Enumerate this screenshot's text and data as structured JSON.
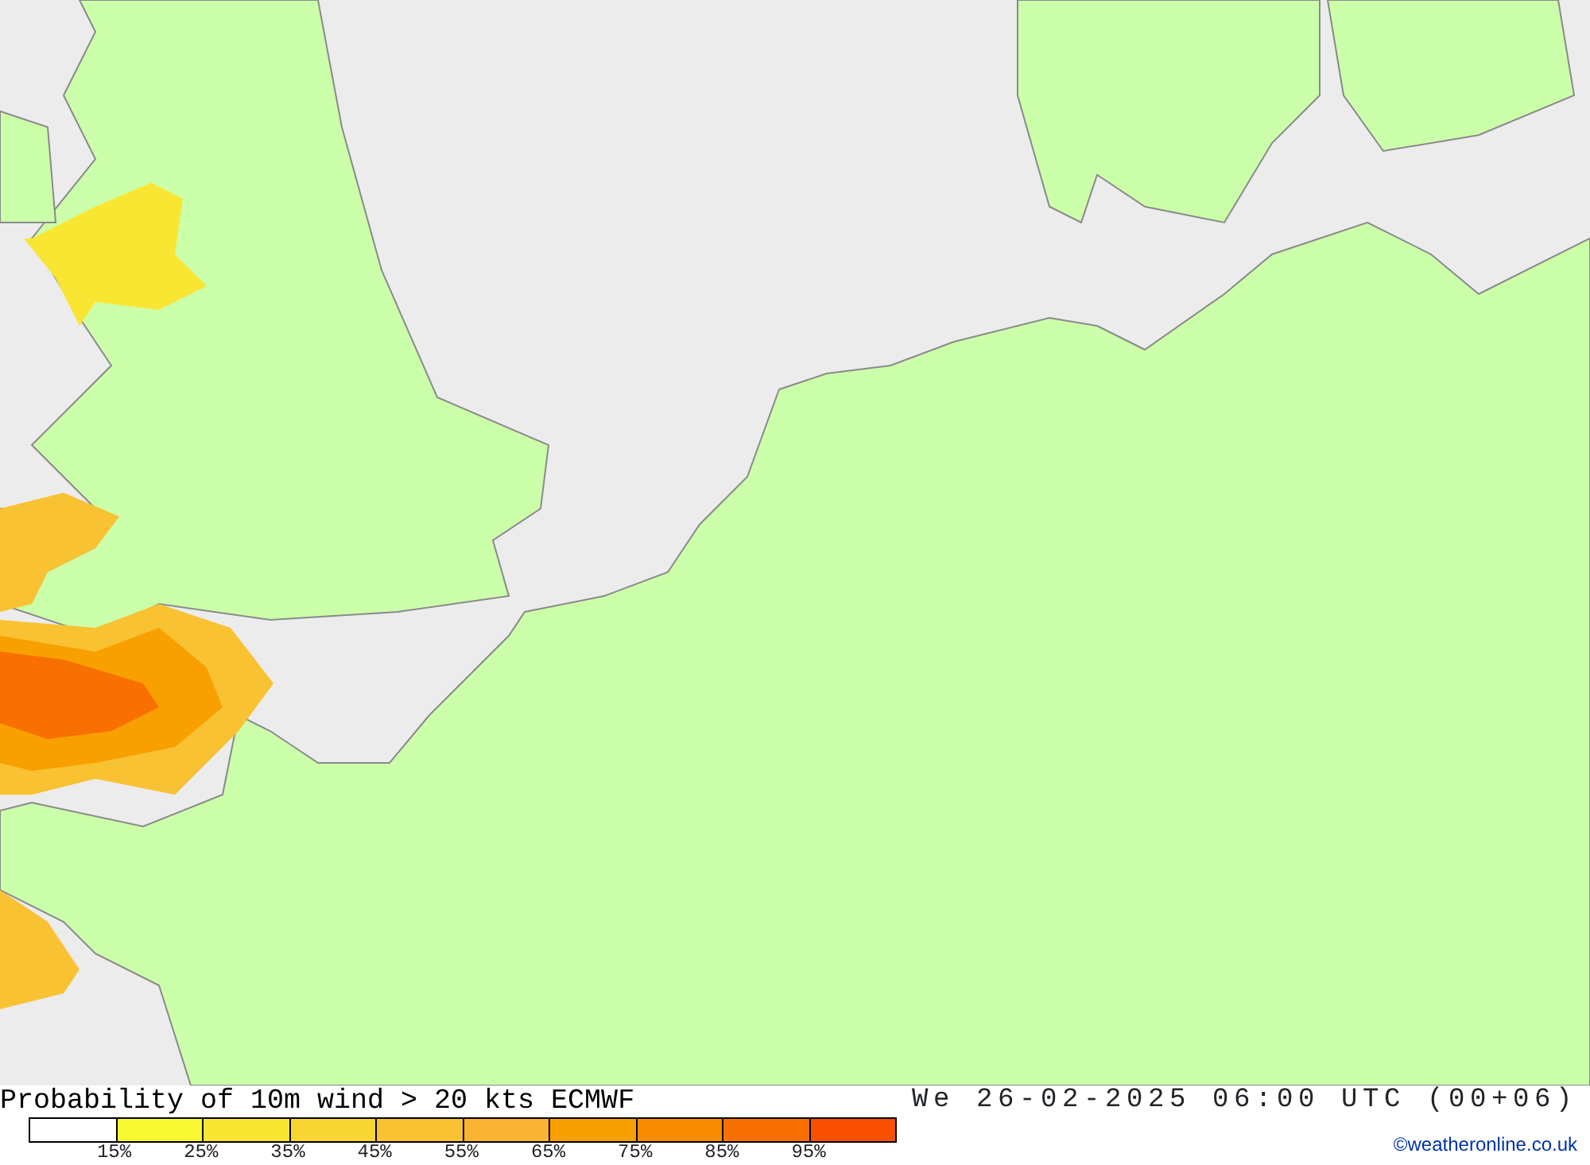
{
  "map": {
    "title": "Probability of 10m wind > 20 kts ECMWF",
    "valid_time": "We 26-02-2025 06:00 UTC (00+06)"
  },
  "legend": [
    {
      "label": "15%",
      "color": "#ffffff"
    },
    {
      "label": "25%",
      "color": "#f8f832"
    },
    {
      "label": "35%",
      "color": "#f8e632"
    },
    {
      "label": "45%",
      "color": "#f8d632"
    },
    {
      "label": "55%",
      "color": "#f8c232"
    },
    {
      "label": "65%",
      "color": "#f8b432"
    },
    {
      "label": "75%",
      "color": "#f8a000"
    },
    {
      "label": "85%",
      "color": "#f88c00"
    },
    {
      "label": "95%",
      "color": "#f87000"
    },
    {
      "color": "#f85000"
    }
  ],
  "credit": "©weatheronline.co.uk"
}
